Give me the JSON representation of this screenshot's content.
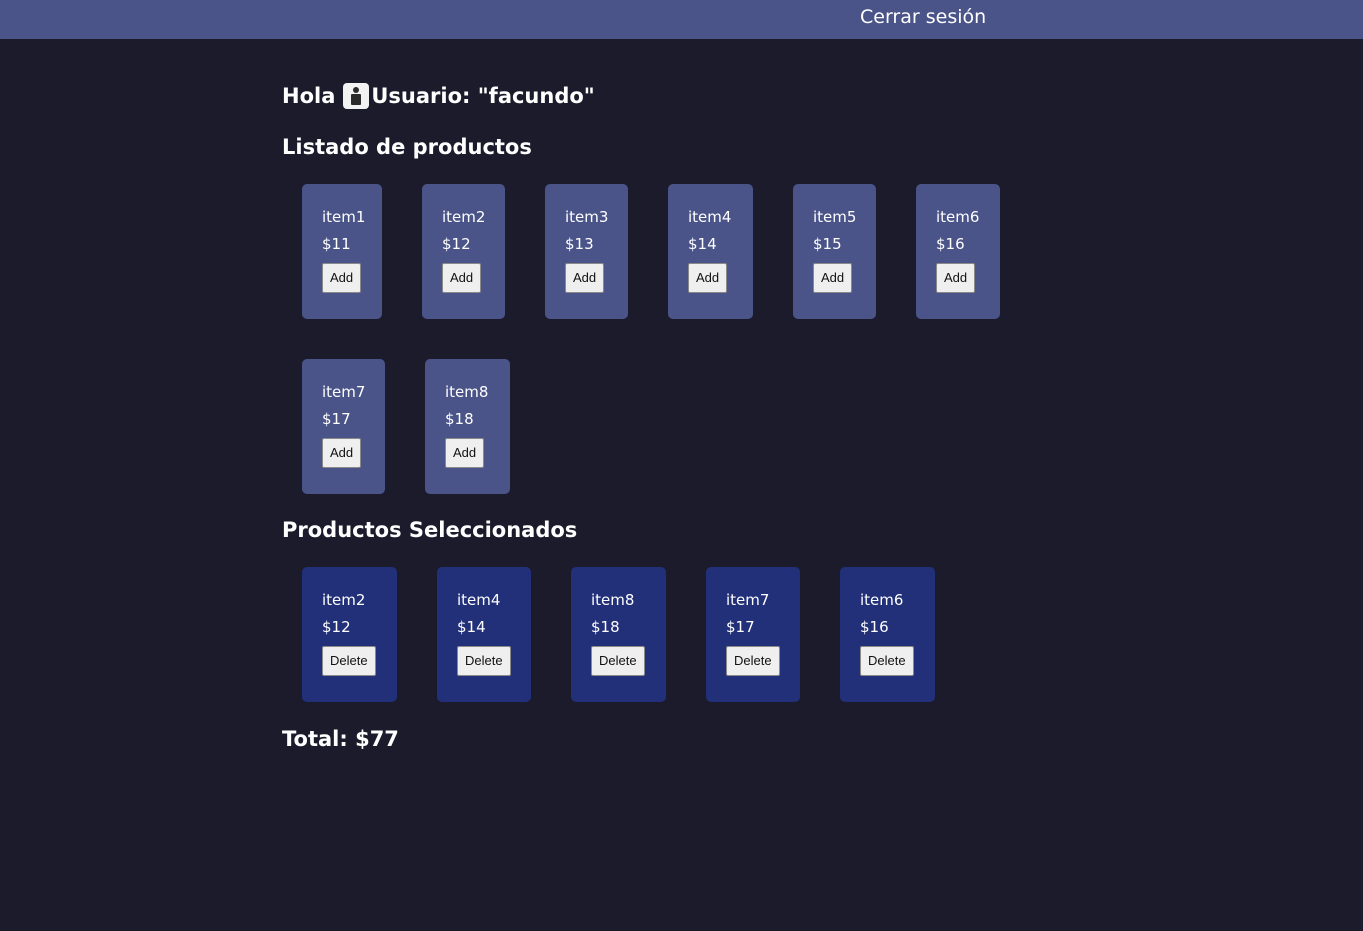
{
  "header": {
    "logout_label": "Cerrar sesión"
  },
  "greeting": {
    "prefix": "Hola",
    "user_label": "Usuario: \"facundo\""
  },
  "products": {
    "title": "Listado de productos",
    "button_label": "Add",
    "items": [
      {
        "name": "item1",
        "price": "$11"
      },
      {
        "name": "item2",
        "price": "$12"
      },
      {
        "name": "item3",
        "price": "$13"
      },
      {
        "name": "item4",
        "price": "$14"
      },
      {
        "name": "item5",
        "price": "$15"
      },
      {
        "name": "item6",
        "price": "$16"
      },
      {
        "name": "item7",
        "price": "$17"
      },
      {
        "name": "item8",
        "price": "$18"
      }
    ]
  },
  "selected": {
    "title": "Productos Seleccionados",
    "button_label": "Delete",
    "items": [
      {
        "name": "item2",
        "price": "$12"
      },
      {
        "name": "item4",
        "price": "$14"
      },
      {
        "name": "item8",
        "price": "$18"
      },
      {
        "name": "item7",
        "price": "$17"
      },
      {
        "name": "item6",
        "price": "$16"
      }
    ]
  },
  "total": "Total: $77",
  "colors": {
    "background": "#1b1b2b",
    "topbar": "#4a5489",
    "product_card": "#4a5489",
    "selected_card": "#213078"
  }
}
